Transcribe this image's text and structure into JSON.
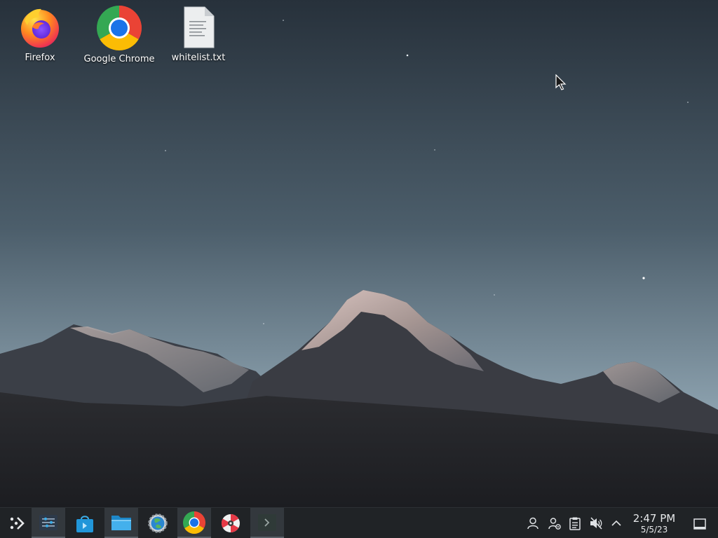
{
  "desktop": {
    "icons": [
      {
        "label": "Firefox",
        "icon": "firefox-icon"
      },
      {
        "label": "Google Chrome",
        "icon": "chrome-icon"
      },
      {
        "label": "whitelist.txt",
        "icon": "text-file-icon"
      }
    ]
  },
  "taskbar": {
    "launcher": {
      "icon": "application-launcher-icon"
    },
    "tasks": [
      {
        "icon": "system-settings-icon",
        "active": true
      },
      {
        "icon": "discover-store-icon",
        "active": false
      },
      {
        "icon": "file-manager-icon",
        "active": true
      },
      {
        "icon": "network-settings-icon",
        "active": false
      },
      {
        "icon": "chrome-icon",
        "active": true
      },
      {
        "icon": "disk-utility-icon",
        "active": false
      },
      {
        "icon": "terminal-icon",
        "active": true
      }
    ],
    "tray": {
      "icons": [
        "user-icon",
        "user-switch-icon",
        "clipboard-icon",
        "volume-muted-icon",
        "chevron-up-icon"
      ],
      "clock": {
        "time": "2:47 PM",
        "date": "5/5/23"
      },
      "show_desktop_icon": "show-desktop-icon"
    }
  },
  "colors": {
    "taskbar_bg": "#202326",
    "sky_top": "#27313b",
    "sky_bottom": "#8a9fac"
  }
}
